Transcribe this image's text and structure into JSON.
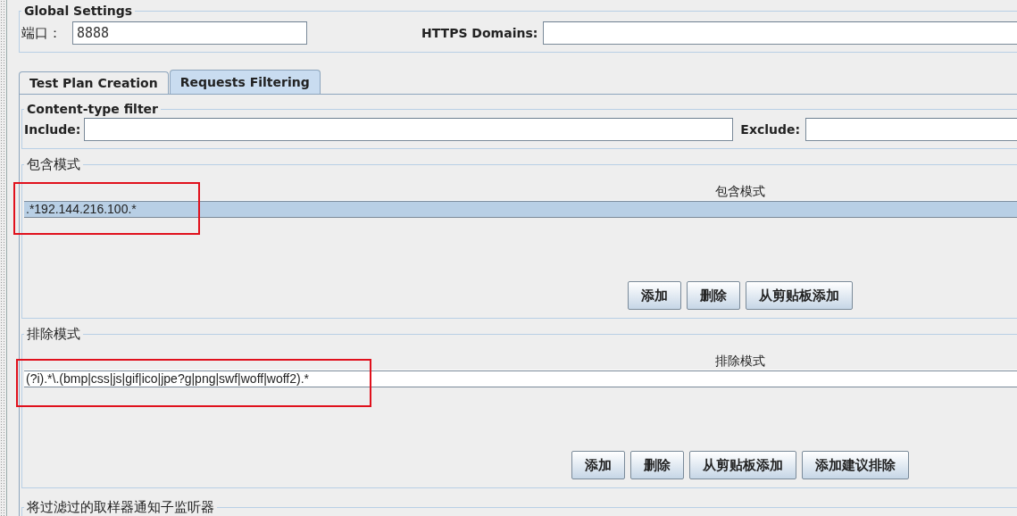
{
  "global_settings": {
    "title": "Global Settings",
    "port": {
      "label": "端口：",
      "value": "8888"
    },
    "https_domains": {
      "label": "HTTPS Domains:"
    }
  },
  "tabs": [
    {
      "label": "Test Plan Creation",
      "selected": false
    },
    {
      "label": "Requests Filtering",
      "selected": true
    }
  ],
  "content_type_filter": {
    "title": "Content-type filter",
    "include_label": "Include:",
    "exclude_label": "Exclude:"
  },
  "pattern_tables": [
    {
      "title": "包含模式",
      "column": "包含模式",
      "highlighted": true,
      "rows": [
        {
          "value": ".*192.144.216.100.*",
          "selected": true
        }
      ],
      "buttons": [
        "添加",
        "删除",
        "从剪贴板添加"
      ]
    },
    {
      "title": "排除模式",
      "column": "排除模式",
      "highlighted": true,
      "rows": [
        {
          "value": "(?i).*\\.(bmp|css|js|gif|ico|jpe?g|png|swf|woff|woff2).*",
          "selected": false
        }
      ],
      "buttons": [
        "添加",
        "删除",
        "从剪贴板添加",
        "添加建议排除"
      ]
    }
  ],
  "notify_section": {
    "title": "将过滤过的取样器通知子监听器"
  }
}
